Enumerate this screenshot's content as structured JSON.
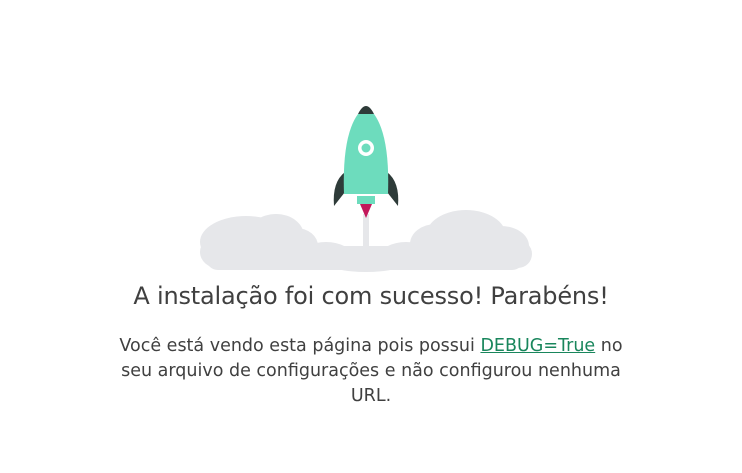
{
  "illustration": {
    "icon": "rocket-launch-icon",
    "colors": {
      "rocket_body": "#6DDCBD",
      "rocket_fins": "#2E3B39",
      "flame": "#C2185B",
      "clouds": "#E6E7EA",
      "exhaust": "#E6E7EA"
    }
  },
  "main": {
    "title": "A instalação foi com sucesso! Parabéns!",
    "message_before": "Você está vendo esta página pois possui ",
    "debug_link": "DEBUG=True",
    "message_after": " no seu arquivo de configurações e não configurou nenhuma URL."
  },
  "colors": {
    "text": "#404040",
    "link": "#19865C",
    "background": "#FFFFFF"
  }
}
